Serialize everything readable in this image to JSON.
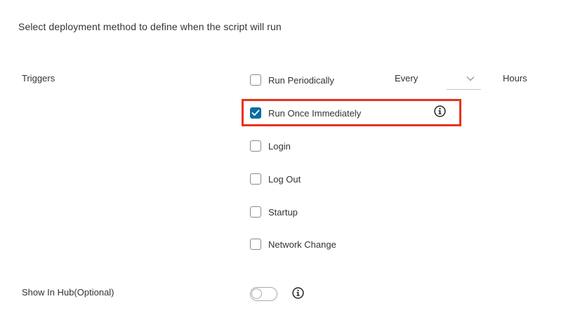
{
  "heading": "Select deployment method to define when the script will run",
  "triggers": {
    "label": "Triggers",
    "options": [
      {
        "label": "Run Periodically",
        "checked": false
      },
      {
        "label": "Run Once Immediately",
        "checked": true
      },
      {
        "label": "Login",
        "checked": false
      },
      {
        "label": "Log Out",
        "checked": false
      },
      {
        "label": "Startup",
        "checked": false
      },
      {
        "label": "Network Change",
        "checked": false
      }
    ],
    "every_label": "Every",
    "every_value": "",
    "hours_label": "Hours",
    "info_icon": "info-circle-icon"
  },
  "show_in_hub": {
    "label": "Show In Hub(Optional)",
    "enabled": false,
    "info_icon": "info-circle-icon"
  },
  "colors": {
    "checkbox_checked": "#0a6da3",
    "highlight": "#e8321c",
    "text": "#333333"
  }
}
